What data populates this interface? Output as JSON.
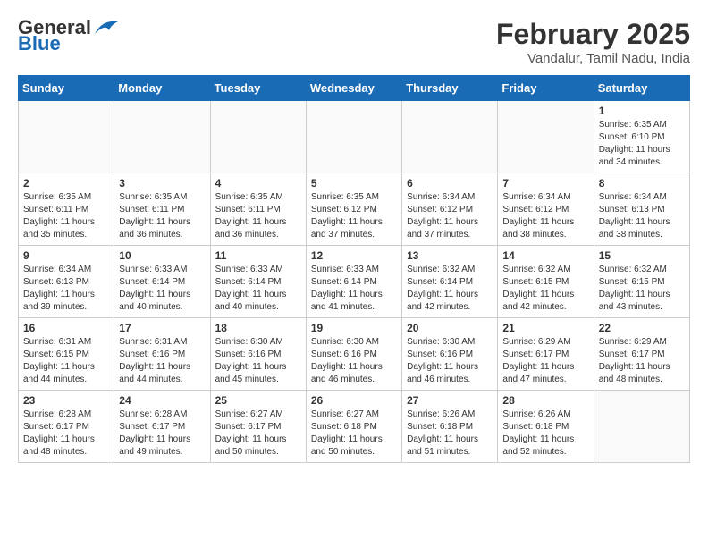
{
  "header": {
    "logo_general": "General",
    "logo_blue": "Blue",
    "month": "February 2025",
    "location": "Vandalur, Tamil Nadu, India"
  },
  "days_of_week": [
    "Sunday",
    "Monday",
    "Tuesday",
    "Wednesday",
    "Thursday",
    "Friday",
    "Saturday"
  ],
  "weeks": [
    [
      {
        "num": "",
        "info": ""
      },
      {
        "num": "",
        "info": ""
      },
      {
        "num": "",
        "info": ""
      },
      {
        "num": "",
        "info": ""
      },
      {
        "num": "",
        "info": ""
      },
      {
        "num": "",
        "info": ""
      },
      {
        "num": "1",
        "info": "Sunrise: 6:35 AM\nSunset: 6:10 PM\nDaylight: 11 hours\nand 34 minutes."
      }
    ],
    [
      {
        "num": "2",
        "info": "Sunrise: 6:35 AM\nSunset: 6:11 PM\nDaylight: 11 hours\nand 35 minutes."
      },
      {
        "num": "3",
        "info": "Sunrise: 6:35 AM\nSunset: 6:11 PM\nDaylight: 11 hours\nand 36 minutes."
      },
      {
        "num": "4",
        "info": "Sunrise: 6:35 AM\nSunset: 6:11 PM\nDaylight: 11 hours\nand 36 minutes."
      },
      {
        "num": "5",
        "info": "Sunrise: 6:35 AM\nSunset: 6:12 PM\nDaylight: 11 hours\nand 37 minutes."
      },
      {
        "num": "6",
        "info": "Sunrise: 6:34 AM\nSunset: 6:12 PM\nDaylight: 11 hours\nand 37 minutes."
      },
      {
        "num": "7",
        "info": "Sunrise: 6:34 AM\nSunset: 6:12 PM\nDaylight: 11 hours\nand 38 minutes."
      },
      {
        "num": "8",
        "info": "Sunrise: 6:34 AM\nSunset: 6:13 PM\nDaylight: 11 hours\nand 38 minutes."
      }
    ],
    [
      {
        "num": "9",
        "info": "Sunrise: 6:34 AM\nSunset: 6:13 PM\nDaylight: 11 hours\nand 39 minutes."
      },
      {
        "num": "10",
        "info": "Sunrise: 6:33 AM\nSunset: 6:14 PM\nDaylight: 11 hours\nand 40 minutes."
      },
      {
        "num": "11",
        "info": "Sunrise: 6:33 AM\nSunset: 6:14 PM\nDaylight: 11 hours\nand 40 minutes."
      },
      {
        "num": "12",
        "info": "Sunrise: 6:33 AM\nSunset: 6:14 PM\nDaylight: 11 hours\nand 41 minutes."
      },
      {
        "num": "13",
        "info": "Sunrise: 6:32 AM\nSunset: 6:14 PM\nDaylight: 11 hours\nand 42 minutes."
      },
      {
        "num": "14",
        "info": "Sunrise: 6:32 AM\nSunset: 6:15 PM\nDaylight: 11 hours\nand 42 minutes."
      },
      {
        "num": "15",
        "info": "Sunrise: 6:32 AM\nSunset: 6:15 PM\nDaylight: 11 hours\nand 43 minutes."
      }
    ],
    [
      {
        "num": "16",
        "info": "Sunrise: 6:31 AM\nSunset: 6:15 PM\nDaylight: 11 hours\nand 44 minutes."
      },
      {
        "num": "17",
        "info": "Sunrise: 6:31 AM\nSunset: 6:16 PM\nDaylight: 11 hours\nand 44 minutes."
      },
      {
        "num": "18",
        "info": "Sunrise: 6:30 AM\nSunset: 6:16 PM\nDaylight: 11 hours\nand 45 minutes."
      },
      {
        "num": "19",
        "info": "Sunrise: 6:30 AM\nSunset: 6:16 PM\nDaylight: 11 hours\nand 46 minutes."
      },
      {
        "num": "20",
        "info": "Sunrise: 6:30 AM\nSunset: 6:16 PM\nDaylight: 11 hours\nand 46 minutes."
      },
      {
        "num": "21",
        "info": "Sunrise: 6:29 AM\nSunset: 6:17 PM\nDaylight: 11 hours\nand 47 minutes."
      },
      {
        "num": "22",
        "info": "Sunrise: 6:29 AM\nSunset: 6:17 PM\nDaylight: 11 hours\nand 48 minutes."
      }
    ],
    [
      {
        "num": "23",
        "info": "Sunrise: 6:28 AM\nSunset: 6:17 PM\nDaylight: 11 hours\nand 48 minutes."
      },
      {
        "num": "24",
        "info": "Sunrise: 6:28 AM\nSunset: 6:17 PM\nDaylight: 11 hours\nand 49 minutes."
      },
      {
        "num": "25",
        "info": "Sunrise: 6:27 AM\nSunset: 6:17 PM\nDaylight: 11 hours\nand 50 minutes."
      },
      {
        "num": "26",
        "info": "Sunrise: 6:27 AM\nSunset: 6:18 PM\nDaylight: 11 hours\nand 50 minutes."
      },
      {
        "num": "27",
        "info": "Sunrise: 6:26 AM\nSunset: 6:18 PM\nDaylight: 11 hours\nand 51 minutes."
      },
      {
        "num": "28",
        "info": "Sunrise: 6:26 AM\nSunset: 6:18 PM\nDaylight: 11 hours\nand 52 minutes."
      },
      {
        "num": "",
        "info": ""
      }
    ]
  ]
}
